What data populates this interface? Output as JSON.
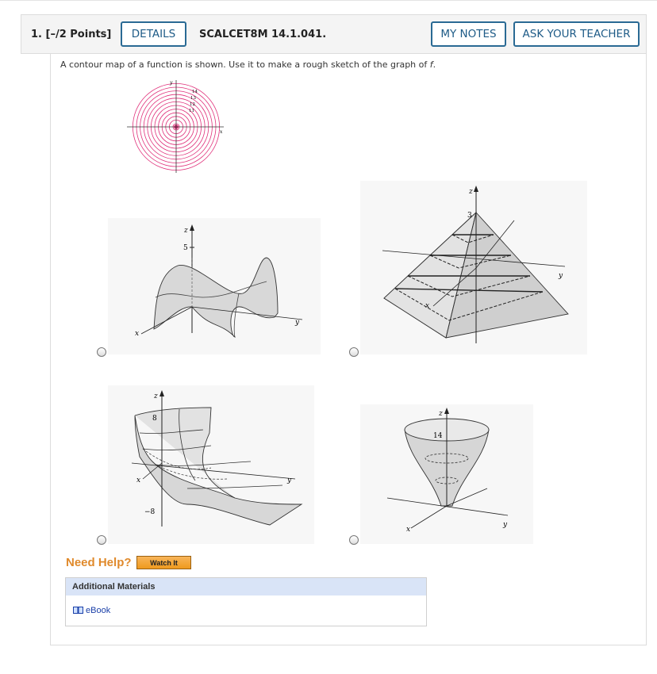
{
  "question": {
    "number_label": "1.",
    "points_label": "[–/2 Points]",
    "details_button": "DETAILS",
    "code": "SCALCET8M 14.1.041.",
    "my_notes_button": "MY NOTES",
    "ask_teacher_button": "ASK YOUR TEACHER"
  },
  "prompt": {
    "text_before": "A contour map of a function is shown. Use it to make a rough sketch of the graph of ",
    "var": "f",
    "text_after": "."
  },
  "contour_map": {
    "labels": [
      "14",
      "13",
      "12",
      "11"
    ],
    "axis_x": "x",
    "axis_y": "y",
    "color": "#e0307a"
  },
  "options": [
    {
      "id": "saddle",
      "z_label": "z",
      "x_label": "x",
      "y_label": "y",
      "tick_label": "5"
    },
    {
      "id": "pyramid",
      "z_label": "z",
      "x_label": "x",
      "y_label": "y",
      "tick_label": "3"
    },
    {
      "id": "sheet",
      "z_label": "z",
      "x_label": "x",
      "y_label": "y",
      "tick_top": "8",
      "tick_bottom": "−8"
    },
    {
      "id": "funnel",
      "z_label": "z",
      "x_label": "x",
      "y_label": "y",
      "tick_label": "14"
    }
  ],
  "help": {
    "need_help": "Need Help?",
    "watch_it": "Watch It",
    "additional_materials": "Additional Materials",
    "ebook": "eBook"
  },
  "colors": {
    "accent": "#1e5b87",
    "orange": "#e08a2c",
    "contour": "#e0307a"
  }
}
